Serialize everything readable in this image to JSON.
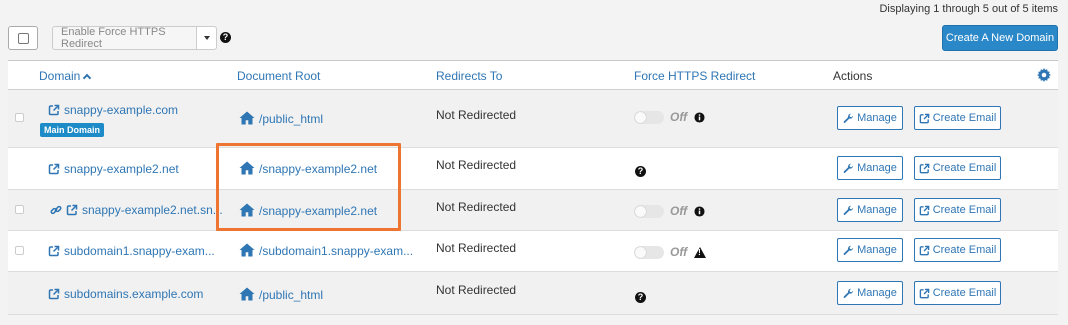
{
  "pagination": {
    "displaying": "Displaying 1 through 5 out of 5 items"
  },
  "toolbar": {
    "bulk_action_label": "Enable Force HTTPS Redirect",
    "create_domain_label": "Create A New Domain"
  },
  "columns": {
    "domain": "Domain",
    "document_root": "Document Root",
    "redirects_to": "Redirects To",
    "force_https": "Force HTTPS Redirect",
    "actions": "Actions"
  },
  "rows": [
    {
      "domain": "snappy-example.com",
      "badge": "Main Domain",
      "document_root": "/public_html",
      "redirects_to": "Not Redirected",
      "https_state": "Off",
      "manage": "Manage",
      "create_email": "Create Email"
    },
    {
      "domain": "snappy-example2.net",
      "document_root": "/snappy-example2.net",
      "redirects_to": "Not Redirected",
      "manage": "Manage",
      "create_email": "Create Email"
    },
    {
      "domain": "snappy-example2.net.sn...",
      "document_root": "/snappy-example2.net",
      "redirects_to": "Not Redirected",
      "https_state": "Off",
      "manage": "Manage",
      "create_email": "Create Email"
    },
    {
      "domain": "subdomain1.snappy-exam...",
      "document_root": "/subdomain1.snappy-exam...",
      "redirects_to": "Not Redirected",
      "https_state": "Off",
      "manage": "Manage",
      "create_email": "Create Email"
    },
    {
      "domain": "subdomains.example.com",
      "document_root": "/public_html",
      "redirects_to": "Not Redirected",
      "manage": "Manage",
      "create_email": "Create Email"
    }
  ],
  "colors": {
    "link": "#2f76b4",
    "primary": "#2a88c9",
    "highlight": "#ee7431",
    "badge": "#1c8bc7"
  }
}
